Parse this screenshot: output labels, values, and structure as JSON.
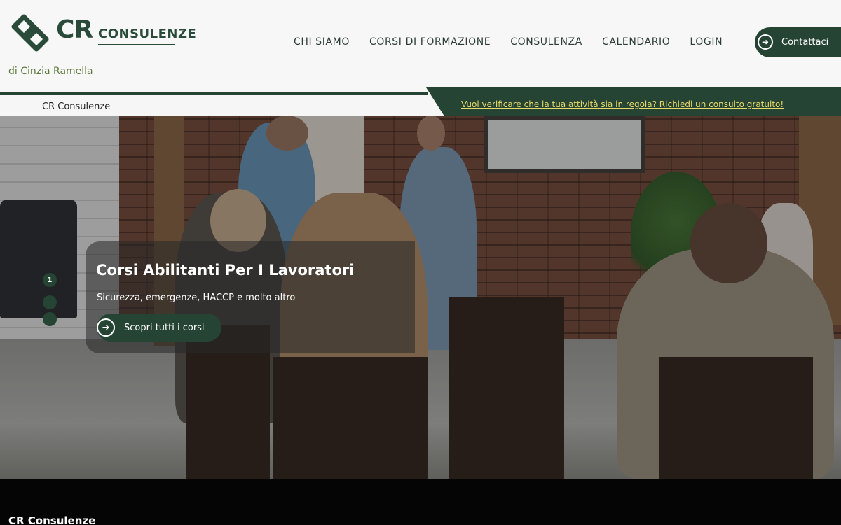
{
  "header": {
    "logo": {
      "brand": "CR",
      "subtitle": "CONSULENZE",
      "tagline": "di Cinzia Ramella"
    },
    "nav": [
      {
        "label": "CHI SIAMO"
      },
      {
        "label": "CORSI DI FORMAZIONE"
      },
      {
        "label": "CONSULENZA"
      },
      {
        "label": "CALENDARIO"
      },
      {
        "label": "LOGIN"
      }
    ],
    "contact_label": "Contattaci"
  },
  "breadcrumb": "CR Consulenze",
  "banner": {
    "text": "Vuoi verificare che la tua attività sia in regola? Richiedi un consulto gratuito!"
  },
  "hero": {
    "title": "Corsi Abilitanti Per I Lavoratori",
    "subtitle": "Sicurezza, emergenze, HACCP e molto altro",
    "button_label": "Scopri tutti i corsi",
    "slides": [
      "1",
      "",
      ""
    ]
  },
  "footer": {
    "title": "CR Consulenze"
  },
  "colors": {
    "brand_green": "#254434",
    "accent_yellow": "#e8d96a",
    "tagline_green": "#5b7a3a"
  }
}
